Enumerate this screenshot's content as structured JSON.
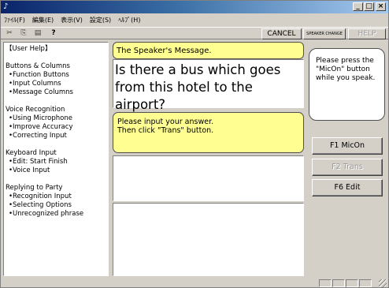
{
  "titlebar": {
    "title": "",
    "min_glyph": "_",
    "max_glyph": "□",
    "close_glyph": "×"
  },
  "menu": [
    "ﾌｧｲﾙ(F)",
    "編集(E)",
    "表示(V)",
    "設定(S)",
    "ﾍﾙﾌﾟ(H)"
  ],
  "toolbar": {
    "cut_icon": "✂",
    "copy_icon": "⎘",
    "paste_icon": "▤",
    "help_icon": "?",
    "cancel_label": "CANCEL",
    "speaker_change_label": "SPEAKER CHANGE",
    "help_label": "HELP"
  },
  "help_panel": {
    "title": "【User Help】",
    "sections": [
      {
        "heading": "Buttons & Columns",
        "items": [
          "•Function Buttons",
          "•Input Columns",
          "•Message Columns"
        ]
      },
      {
        "heading": "Voice Recognition",
        "items": [
          "•Using Microphone",
          "•Improve Accuracy",
          "•Correcting Input"
        ]
      },
      {
        "heading": "Keyboard Input",
        "items": [
          "•Edit: Start Finish",
          "•Voice Input"
        ]
      },
      {
        "heading": "Replying to Party",
        "items": [
          "•Recognition Input",
          "•Selecting Options",
          "•Unrecognized phrase"
        ]
      }
    ]
  },
  "speaker": {
    "label": "The Speaker's Message.",
    "message": "Is there a bus which goes from this hotel to the airport?"
  },
  "prompt": {
    "line1": "Please input your answer.",
    "line2": "Then click \"Trans\" button."
  },
  "instructions": "Please press the \"MicOn\" button while you speak.",
  "buttons": {
    "mic_on": "F1 MicOn",
    "trans": "F2 Trans",
    "edit": "F6 Edit"
  },
  "colors": {
    "highlight_yellow": "#fffe90",
    "window_gray": "#d4d0c8"
  }
}
